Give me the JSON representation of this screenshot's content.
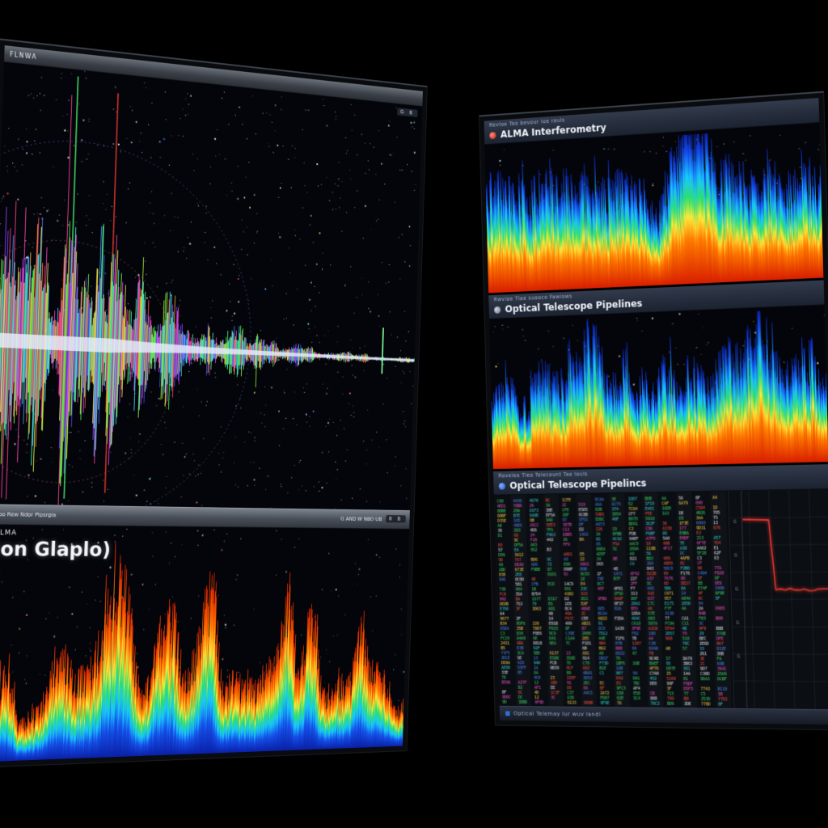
{
  "left_monitor": {
    "top_bar": {
      "title": "FLNWA"
    },
    "sky_panel": {
      "corner_badge": "G B"
    },
    "mid_bar": {
      "left_text": "Boo Rew Ndor Pipsrgia",
      "right_text": "G AND W NBO UB",
      "badge": "6 B"
    },
    "lower_panel": {
      "kicker": "ALMA",
      "title": "(on Glaplo)"
    }
  },
  "right_monitor": {
    "panels": [
      {
        "tab_text": "Revloe Too bevour loe rouls",
        "title": "ALMA Interferometry",
        "plot": "spectrogram-blue-tips"
      },
      {
        "tab_text": "Rwvloe Tlae suooce Fawlows",
        "title": "Optical Telescope Pipelines",
        "plot": "spectrogram-blue-tips"
      },
      {
        "tab_text": "Rovelea Tieo Telecount Tae louls",
        "title": "Optical Telescope Pipelincs",
        "plot": "log-table-and-line-chart"
      }
    ],
    "bottom_bar": {
      "text": "Optical Telemay lur wuv landi"
    }
  },
  "palette": {
    "screen_bg": "#04050a",
    "log_bg": "#0a0d12",
    "chart_bg": "#0b0e13",
    "chart_line": "#ff3b30",
    "grid_line": "rgba(160,175,200,0.10)",
    "green_marker": "rgba(80,255,120,0.85)",
    "red_marker": "rgba(255,60,50,0.85)",
    "circle_blue": "rgba(90,140,255,0.5)",
    "circle_pink": "rgba(255,110,150,0.45)",
    "star_colors": [
      "#ffffff",
      "#c8d2ff",
      "#ff6655",
      "#55aaff",
      "#66ff88",
      "#ffdd55",
      "#ff66cc"
    ],
    "log_colors": [
      "#3ddc68",
      "#e5e9f0",
      "#ff5544",
      "#4d8dff",
      "#ff55cc",
      "#ffd24a",
      "#35d8e0"
    ],
    "flame_up": [
      [
        0,
        "#0a20a8"
      ],
      [
        0.18,
        "#1550e8"
      ],
      [
        0.32,
        "#19c8ff"
      ],
      [
        0.46,
        "#2ce06a"
      ],
      [
        0.6,
        "#ffe93a"
      ],
      [
        0.75,
        "#ff7a00"
      ],
      [
        1,
        "#d81e00"
      ]
    ],
    "flame_down": [
      [
        0,
        "#d81e00"
      ],
      [
        0.3,
        "#ff7a00"
      ],
      [
        0.45,
        "#ffe93a"
      ],
      [
        0.58,
        "#2ce06a"
      ],
      [
        0.72,
        "#19c8ff"
      ],
      [
        0.88,
        "#1550e8"
      ],
      [
        1,
        "#0a20a8"
      ]
    ]
  }
}
